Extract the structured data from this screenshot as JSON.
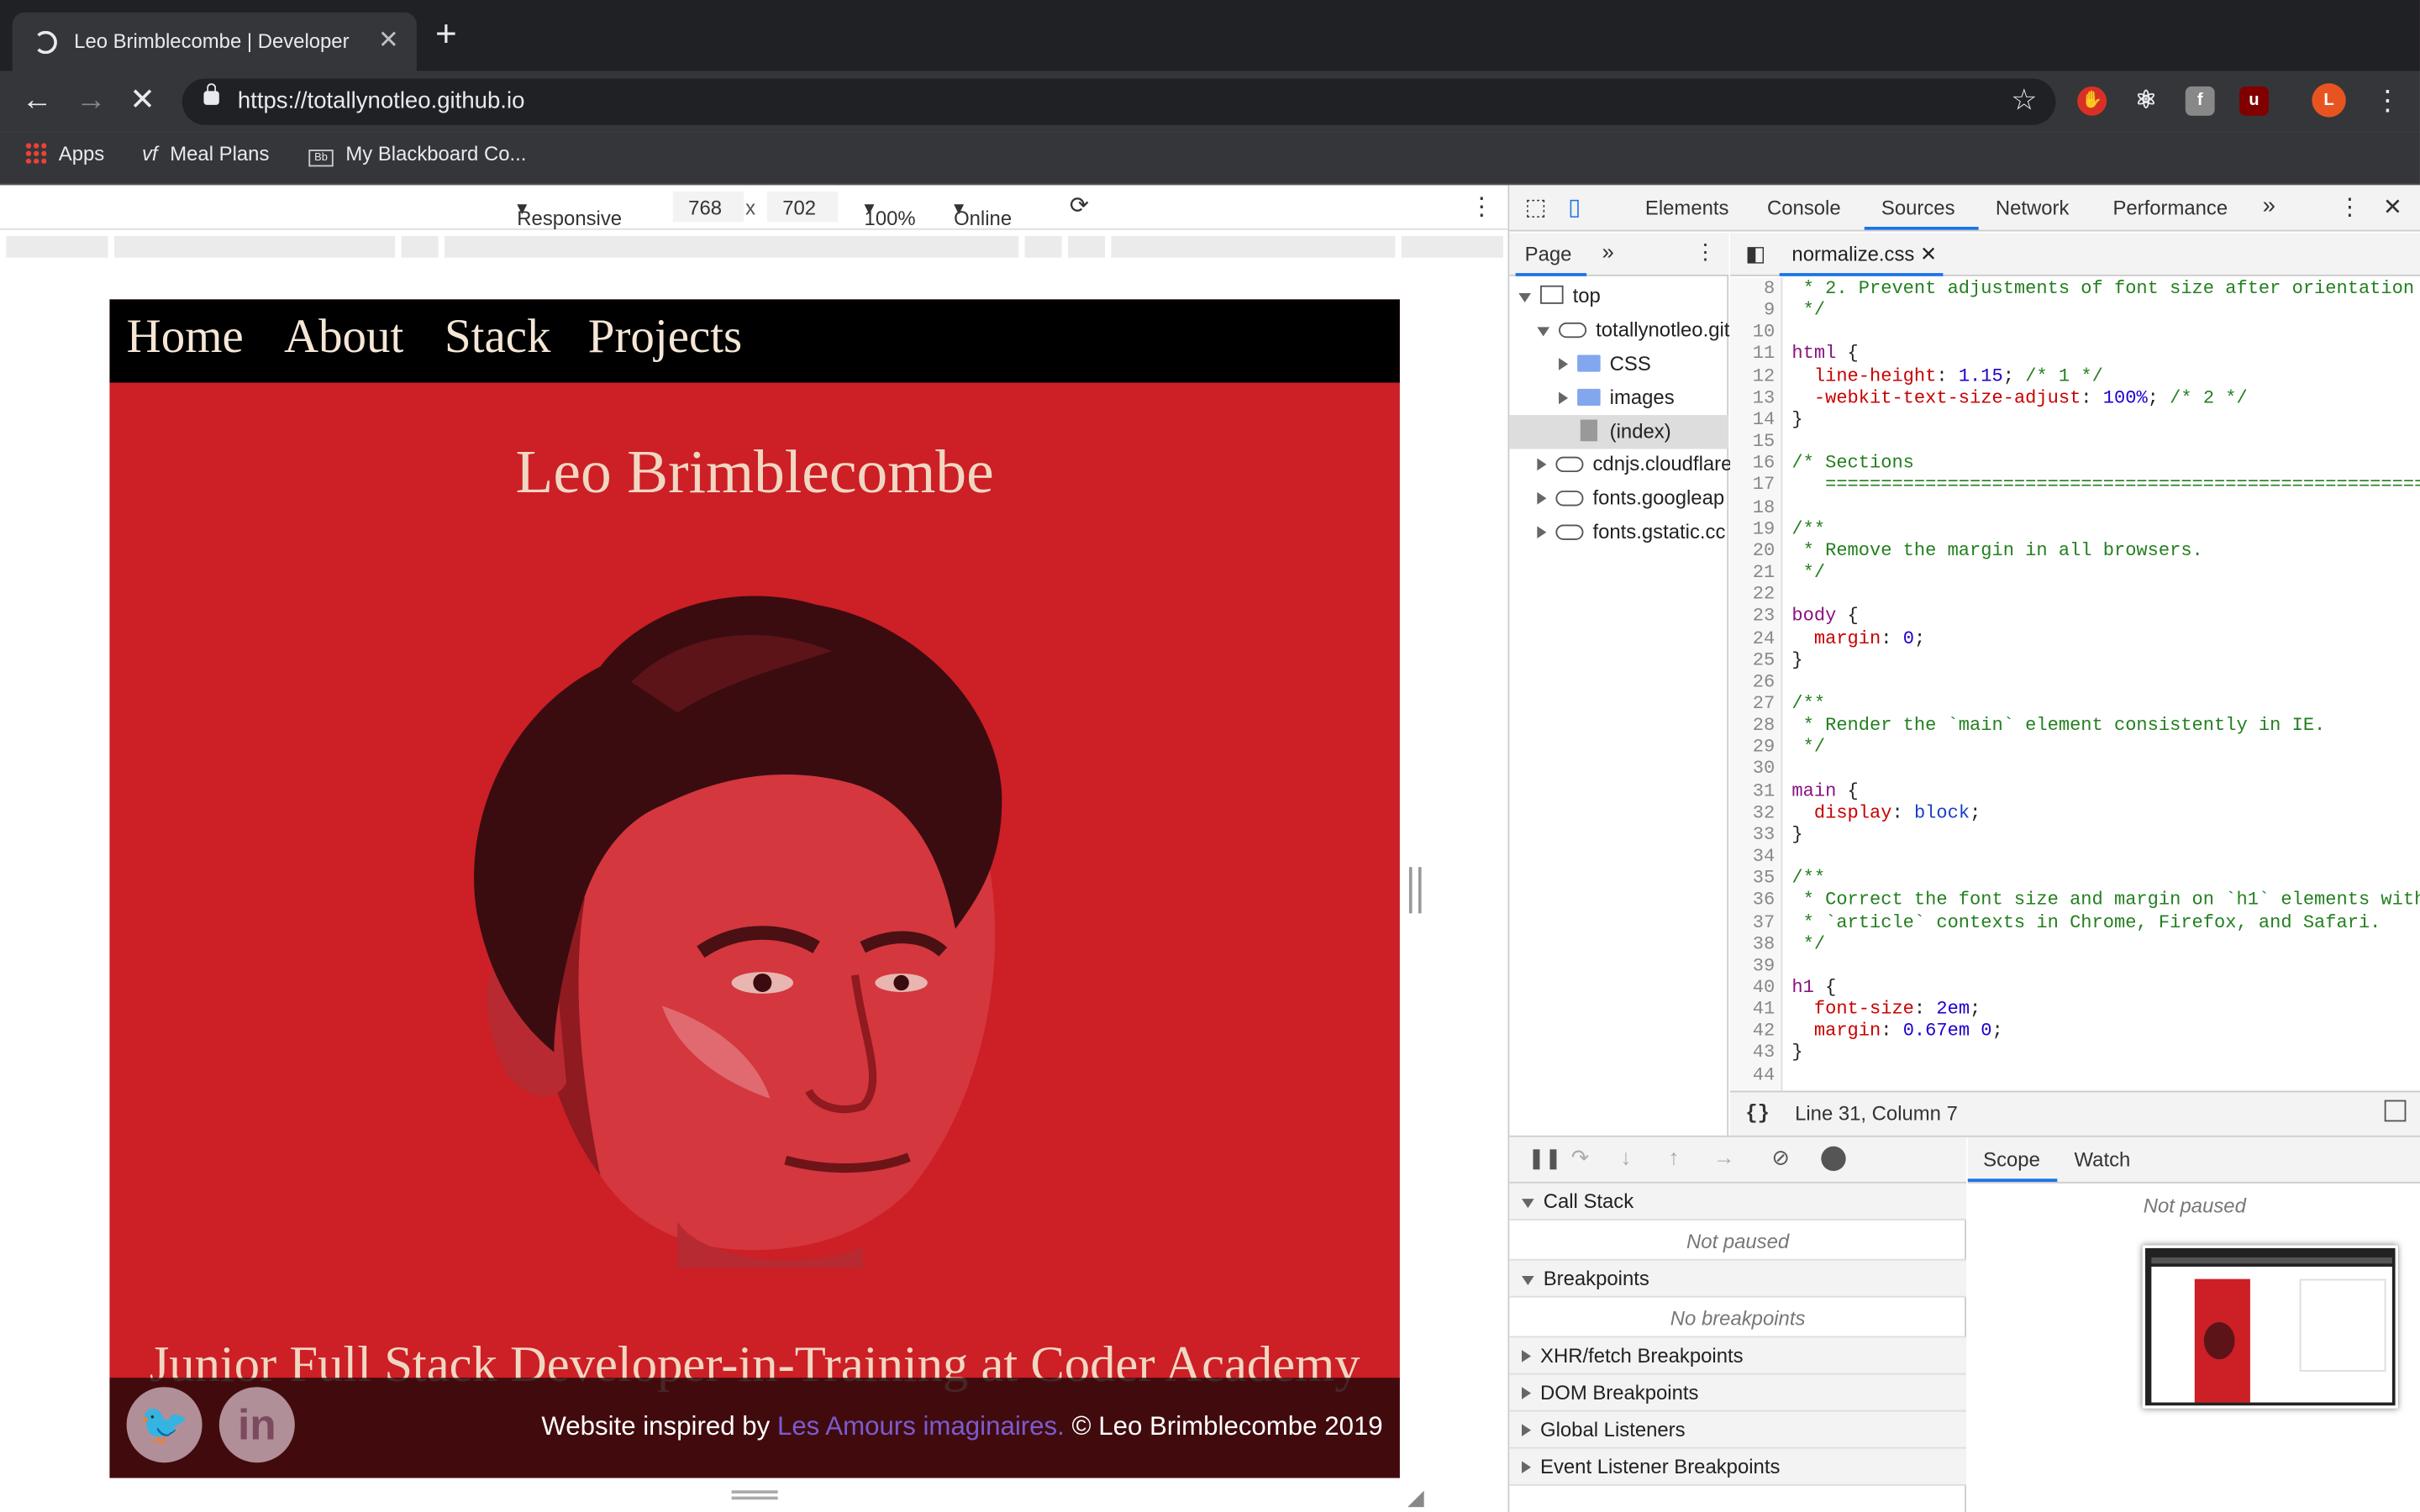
{
  "browser": {
    "tab_title": "Leo Brimblecombe | Developer",
    "url": "https://totallynotleo.github.io",
    "bookmarks": [
      {
        "label": "Apps"
      },
      {
        "label": "Meal Plans"
      },
      {
        "label": "My Blackboard Co..."
      }
    ],
    "profile_initial": "L"
  },
  "device_toolbar": {
    "mode": "Responsive",
    "width": "768",
    "times": "x",
    "height": "702",
    "zoom": "100%",
    "network": "Online"
  },
  "site": {
    "nav": [
      "Home",
      "About",
      "Stack",
      "Projects"
    ],
    "name": "Leo Brimblecombe",
    "tagline": "Junior Full Stack Developer-in-Training at Coder Academy",
    "credit_prefix": "Website inspired by",
    "credit_link": "Les Amours imaginaires.",
    "credit_suffix": "© Leo Brimblecombe 2019"
  },
  "devtools": {
    "tabs": [
      "Elements",
      "Console",
      "Sources",
      "Network",
      "Performance"
    ],
    "active_tab": "Sources",
    "navigator_tab": "Page",
    "tree": {
      "top": "top",
      "origin": "totallynotleo.git",
      "css": "CSS",
      "images": "images",
      "index": "(index)",
      "cdn1": "cdnjs.cloudflare",
      "cdn2": "fonts.googleap",
      "cdn3": "fonts.gstatic.cc"
    },
    "open_file": "normalize.css",
    "status": "Line 31, Column 7",
    "sections": {
      "call_stack": "Call Stack",
      "not_paused": "Not paused",
      "breakpoints": "Breakpoints",
      "no_breakpoints": "No breakpoints",
      "xhr": "XHR/fetch Breakpoints",
      "dom": "DOM Breakpoints",
      "listeners": "Global Listeners",
      "event": "Event Listener Breakpoints"
    },
    "scope_tab": "Scope",
    "watch_tab": "Watch",
    "scope_not_paused": "Not paused"
  }
}
